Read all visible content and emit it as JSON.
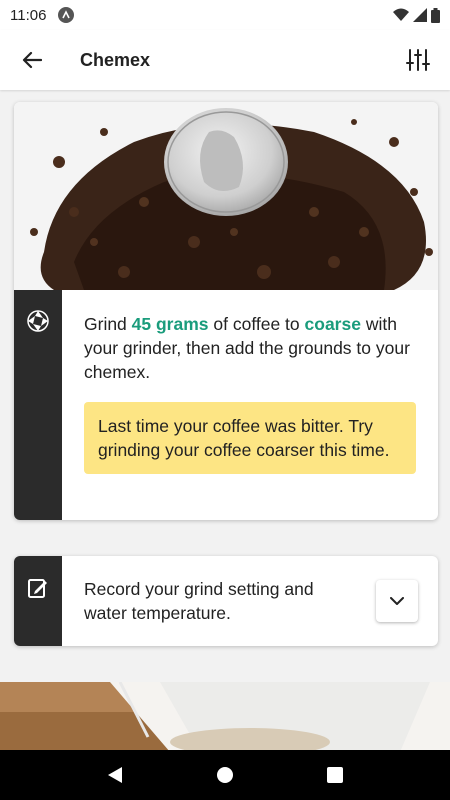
{
  "status_bar": {
    "time": "11:06",
    "badge_icon": "a-icon",
    "icons": [
      "wifi-icon",
      "signal-icon",
      "battery-icon"
    ]
  },
  "app_bar": {
    "title": "Chemex",
    "back_icon": "arrow-back-icon",
    "settings_icon": "tune-sliders-icon"
  },
  "step_card": {
    "side_icon": "aperture-icon",
    "text_before": "Grind ",
    "amount": "45 grams",
    "text_middle": " of coffee to ",
    "grind": "coarse",
    "text_after": " with your grinder, then add the grounds to your chemex.",
    "tip": "Last time your coffee was bitter. Try grinding your coffee coarser this time."
  },
  "record_card": {
    "side_icon": "edit-note-icon",
    "text": "Record your grind setting and water temperature.",
    "expand_icon": "chevron-down-icon"
  },
  "colors": {
    "accent": "#1a9c7c",
    "tip_background": "#fde584",
    "side_bar": "#2b2b2b"
  },
  "nav_bar": {
    "back": "nav-back-icon",
    "home": "nav-home-icon",
    "recents": "nav-recents-icon"
  }
}
